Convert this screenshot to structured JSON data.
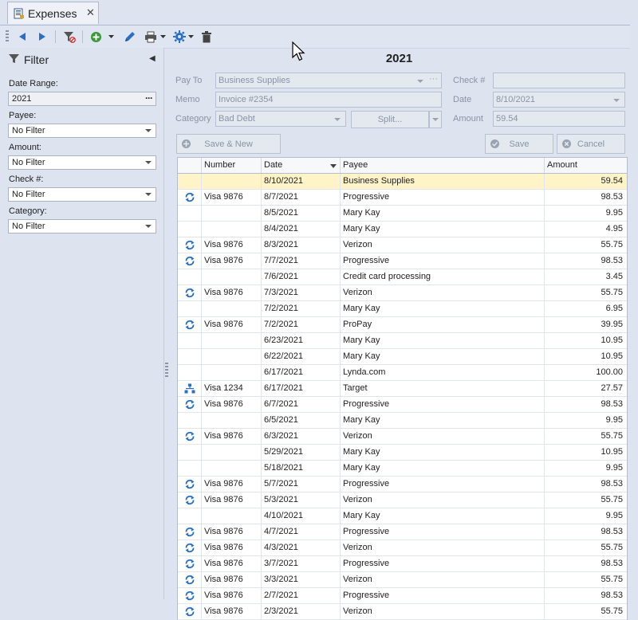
{
  "tab": {
    "title": "Expenses",
    "close": "✕"
  },
  "filter": {
    "title": "Filter",
    "date_range_label": "Date Range:",
    "date_range_value": "2021",
    "payee_label": "Payee:",
    "payee_value": "No Filter",
    "amount_label": "Amount:",
    "amount_value": "No Filter",
    "check_label": "Check #:",
    "check_value": "No Filter",
    "category_label": "Category:",
    "category_value": "No Filter"
  },
  "form": {
    "year": "2021",
    "payto_label": "Pay To",
    "payto_value": "Business Supplies",
    "memo_label": "Memo",
    "memo_value": "Invoice #2354",
    "category_label": "Category",
    "category_value": "Bad Debt",
    "split_label": "Split...",
    "check_label": "Check #",
    "check_value": "",
    "date_label": "Date",
    "date_value": "8/10/2021",
    "amount_label": "Amount",
    "amount_value": "59.54",
    "save_new_label": "Save & New",
    "save_label": "Save",
    "cancel_label": "Cancel"
  },
  "grid": {
    "headers": [
      "",
      "Number",
      "Date",
      "Payee",
      "Amount"
    ],
    "rows": [
      {
        "icon": "",
        "number": "",
        "date": "8/10/2021",
        "payee": "Business Supplies",
        "amount": "59.54"
      },
      {
        "icon": "recurring-icon",
        "number": "Visa 9876",
        "date": "8/7/2021",
        "payee": "Progressive",
        "amount": "98.53"
      },
      {
        "icon": "",
        "number": "",
        "date": "8/5/2021",
        "payee": "Mary Kay",
        "amount": "9.95"
      },
      {
        "icon": "",
        "number": "",
        "date": "8/4/2021",
        "payee": "Mary Kay",
        "amount": "4.95"
      },
      {
        "icon": "recurring-icon",
        "number": "Visa 9876",
        "date": "8/3/2021",
        "payee": "Verizon",
        "amount": "55.75"
      },
      {
        "icon": "recurring-icon",
        "number": "Visa 9876",
        "date": "7/7/2021",
        "payee": "Progressive",
        "amount": "98.53"
      },
      {
        "icon": "",
        "number": "",
        "date": "7/6/2021",
        "payee": "Credit card processing",
        "amount": "3.45"
      },
      {
        "icon": "recurring-icon",
        "number": "Visa 9876",
        "date": "7/3/2021",
        "payee": "Verizon",
        "amount": "55.75"
      },
      {
        "icon": "",
        "number": "",
        "date": "7/2/2021",
        "payee": "Mary Kay",
        "amount": "6.95"
      },
      {
        "icon": "recurring-icon",
        "number": "Visa 9876",
        "date": "7/2/2021",
        "payee": "ProPay",
        "amount": "39.95"
      },
      {
        "icon": "",
        "number": "",
        "date": "6/23/2021",
        "payee": "Mary Kay",
        "amount": "10.95"
      },
      {
        "icon": "",
        "number": "",
        "date": "6/22/2021",
        "payee": "Mary Kay",
        "amount": "10.95"
      },
      {
        "icon": "",
        "number": "",
        "date": "6/17/2021",
        "payee": "Lynda.com",
        "amount": "100.00"
      },
      {
        "icon": "split-icon",
        "number": "Visa 1234",
        "date": "6/17/2021",
        "payee": "Target",
        "amount": "27.57"
      },
      {
        "icon": "recurring-icon",
        "number": "Visa 9876",
        "date": "6/7/2021",
        "payee": "Progressive",
        "amount": "98.53"
      },
      {
        "icon": "",
        "number": "",
        "date": "6/5/2021",
        "payee": "Mary Kay",
        "amount": "9.95"
      },
      {
        "icon": "recurring-icon",
        "number": "Visa 9876",
        "date": "6/3/2021",
        "payee": "Verizon",
        "amount": "55.75"
      },
      {
        "icon": "",
        "number": "",
        "date": "5/29/2021",
        "payee": "Mary Kay",
        "amount": "10.95"
      },
      {
        "icon": "",
        "number": "",
        "date": "5/18/2021",
        "payee": "Mary Kay",
        "amount": "9.95"
      },
      {
        "icon": "recurring-icon",
        "number": "Visa 9876",
        "date": "5/7/2021",
        "payee": "Progressive",
        "amount": "98.53"
      },
      {
        "icon": "recurring-icon",
        "number": "Visa 9876",
        "date": "5/3/2021",
        "payee": "Verizon",
        "amount": "55.75"
      },
      {
        "icon": "",
        "number": "",
        "date": "4/10/2021",
        "payee": "Mary Kay",
        "amount": "9.95"
      },
      {
        "icon": "recurring-icon",
        "number": "Visa 9876",
        "date": "4/7/2021",
        "payee": "Progressive",
        "amount": "98.53"
      },
      {
        "icon": "recurring-icon",
        "number": "Visa 9876",
        "date": "4/3/2021",
        "payee": "Verizon",
        "amount": "55.75"
      },
      {
        "icon": "recurring-icon",
        "number": "Visa 9876",
        "date": "3/7/2021",
        "payee": "Progressive",
        "amount": "98.53"
      },
      {
        "icon": "recurring-icon",
        "number": "Visa 9876",
        "date": "3/3/2021",
        "payee": "Verizon",
        "amount": "55.75"
      },
      {
        "icon": "recurring-icon",
        "number": "Visa 9876",
        "date": "2/7/2021",
        "payee": "Progressive",
        "amount": "98.53"
      },
      {
        "icon": "recurring-icon",
        "number": "Visa 9876",
        "date": "2/3/2021",
        "payee": "Verizon",
        "amount": "55.75"
      }
    ]
  },
  "colors": {
    "accent": "#2b6fc4",
    "selected_row": "#fff3c8",
    "add_green": "#3a9a3a"
  }
}
